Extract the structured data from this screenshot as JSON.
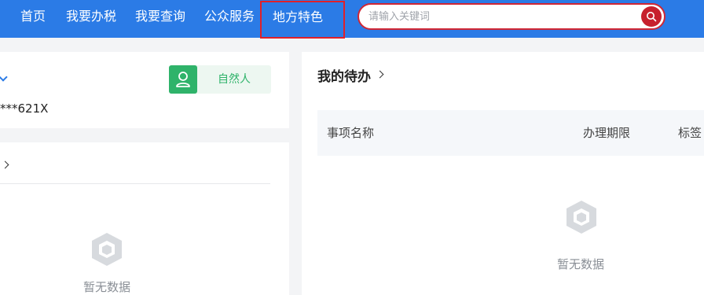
{
  "nav": {
    "items": [
      {
        "label": "首页"
      },
      {
        "label": "我要办税"
      },
      {
        "label": "我要查询"
      },
      {
        "label": "公众服务"
      },
      {
        "label": "地方特色"
      }
    ],
    "active_index": 4
  },
  "search": {
    "placeholder": "请输入关键词",
    "value": ""
  },
  "user_card": {
    "id_masked": "***621X",
    "identity_badge": "自然人"
  },
  "list_card": {
    "title_tail": "›",
    "empty_text": "暂无数据"
  },
  "todo": {
    "title": "我的待办",
    "columns": [
      "事项名称",
      "办理期限",
      "标签"
    ],
    "empty_text": "暂无数据"
  },
  "colors": {
    "nav_bg": "#2b7be6",
    "search_accent": "#c7202d",
    "badge_green": "#2fb36a",
    "page_bg": "#f3f4f6"
  },
  "icons": {
    "search_button": "search-icon",
    "badge": "person-icon",
    "empty": "empty-box-icon"
  }
}
